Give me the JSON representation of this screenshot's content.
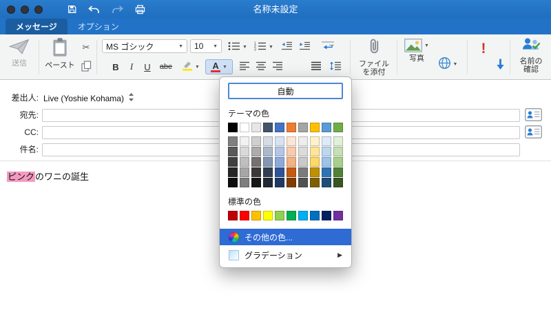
{
  "window": {
    "title": "名称未設定"
  },
  "tabs": [
    {
      "label": "メッセージ",
      "active": true
    },
    {
      "label": "オプション",
      "active": false
    }
  ],
  "ribbon": {
    "send": "送信",
    "paste": "ペースト",
    "font_name": "MS ゴシック",
    "font_size": "10",
    "bold": "B",
    "italic": "I",
    "underline": "U",
    "strikethrough": "abe",
    "attach_line1": "ファイル",
    "attach_line2": "を添付",
    "photo": "写真",
    "check_names_line1": "名前の",
    "check_names_line2": "確認"
  },
  "fields": {
    "from_label": "差出人:",
    "from_value": "Live (Yoshie Kohama)",
    "to_label": "宛先:",
    "to_value": "",
    "cc_label": "CC:",
    "cc_value": "",
    "subject_label": "件名:",
    "subject_value": ""
  },
  "body": {
    "highlighted_text": "ピンク",
    "text": "のワニの誕生",
    "highlight_color": "#F49AC1"
  },
  "color_picker": {
    "automatic_label": "自動",
    "theme_section_label": "テーマの色",
    "standard_section_label": "標準の色",
    "more_colors_label": "その他の色...",
    "gradient_label": "グラデーション",
    "selection_color": "#2E6BD4",
    "theme_colors": [
      "#000000",
      "#FFFFFF",
      "#E7E6E6",
      "#44546A",
      "#4472C4",
      "#ED7D31",
      "#A5A5A5",
      "#FFC000",
      "#5B9BD5",
      "#70AD47"
    ],
    "theme_variants": [
      [
        "#7F7F7F",
        "#F2F2F2",
        "#D0CECE",
        "#D6DCE4",
        "#D9E2F3",
        "#FBE5D5",
        "#EDEDED",
        "#FFF2CC",
        "#DEEBF7",
        "#E2EFD9"
      ],
      [
        "#595959",
        "#D9D9D9",
        "#AEABAB",
        "#ACB9CA",
        "#B4C6E7",
        "#F7CBAC",
        "#DBDBDB",
        "#FFE599",
        "#BDD7EE",
        "#C5E0B3"
      ],
      [
        "#404040",
        "#BFBFBF",
        "#767171",
        "#8496B0",
        "#8EAADB",
        "#F4B183",
        "#C9C9C9",
        "#FFD966",
        "#9DC3E6",
        "#A8D08D"
      ],
      [
        "#262626",
        "#A6A6A6",
        "#3B3838",
        "#333F50",
        "#2F5496",
        "#C55A11",
        "#7B7B7B",
        "#BF9000",
        "#2E74B5",
        "#538135"
      ],
      [
        "#0D0D0D",
        "#7F7F7F",
        "#181717",
        "#222A35",
        "#1F3864",
        "#833C00",
        "#525252",
        "#7F6000",
        "#1F4D78",
        "#375623"
      ]
    ],
    "standard_colors": [
      "#C00000",
      "#FF0000",
      "#FFC000",
      "#FFFF00",
      "#92D050",
      "#00B050",
      "#00B0F0",
      "#0070C0",
      "#002060",
      "#7030A0"
    ]
  },
  "icons": {
    "caret": "▼",
    "submenu_arrow": "▶",
    "scissors": "✂",
    "high_importance": "!"
  },
  "colors": {
    "titlebar_blue": "#2273C8",
    "active_tab_blue": "#1A5DA1",
    "high_importance_red": "#CF3A2B",
    "low_importance_blue": "#2B7CD3",
    "font_color_indicator": "#E03131",
    "highlight_indicator": "#FFE600"
  }
}
